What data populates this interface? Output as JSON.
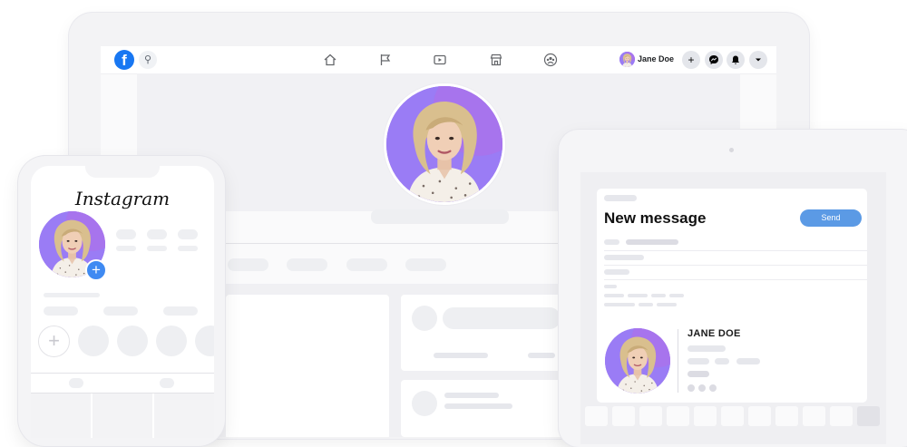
{
  "facebook": {
    "logo": "f",
    "search_icon": "search-icon",
    "nav_icons": [
      "home-icon",
      "flag-icon",
      "video-icon",
      "marketplace-icon",
      "groups-icon"
    ],
    "user_name": "Jane Doe",
    "actions": [
      "+",
      "messenger-icon",
      "bell-icon",
      "chevron-down-icon"
    ]
  },
  "instagram": {
    "title": "Instagram",
    "add_story": "+"
  },
  "messenger": {
    "title": "New message",
    "send_label": "Send",
    "contact_name": "JANE DOE"
  },
  "colors": {
    "facebook_blue": "#1877f2",
    "send_blue": "#5b9ae5",
    "avatar_purple": "#9a7cf5"
  }
}
